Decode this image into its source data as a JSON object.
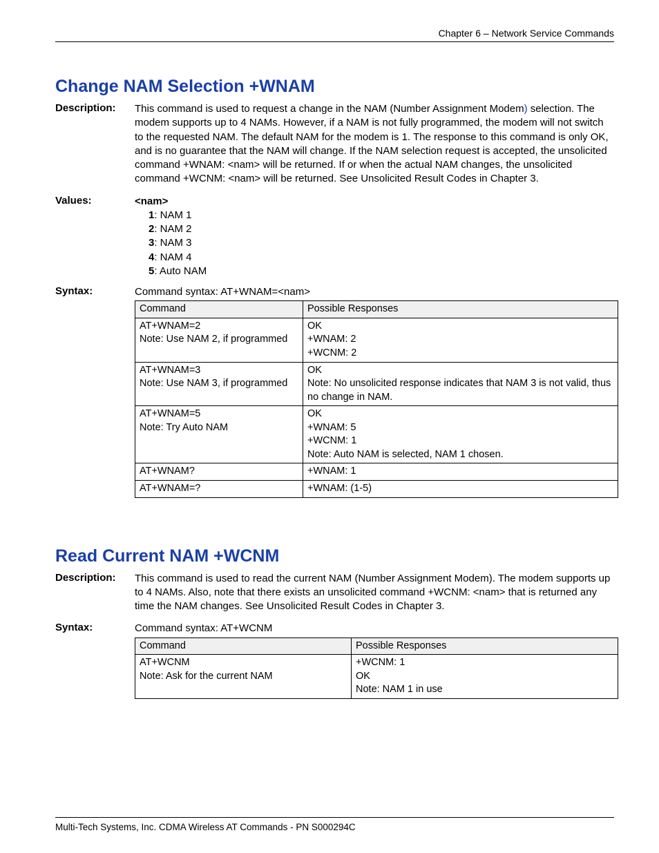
{
  "header": {
    "chapter": "Chapter 6 – Network Service Commands"
  },
  "section1": {
    "title": "Change NAM Selection  +WNAM",
    "labels": {
      "description": "Description:",
      "values": "Values:",
      "syntax": "Syntax:"
    },
    "description_a": "This command is used to request a change in the NAM (Number Assignment Modem",
    "description_paren": ")",
    "description_b": " selection. The modem supports up to 4 NAMs. However, if a NAM is not fully programmed, the modem will not switch to the requested NAM. The default NAM for the modem is 1. The response to this command is only OK, and is no guarantee that the NAM will change. If the NAM selection request is accepted, the unsolicited command +WNAM: <nam> will be returned. If or when the actual NAM changes, the unsolicited command +WCNM: <nam> will be returned. See Unsolicited Result Codes in Chapter 3.",
    "values_header": "<nam>",
    "values": [
      {
        "n": "1",
        "t": ": NAM 1"
      },
      {
        "n": "2",
        "t": ": NAM 2"
      },
      {
        "n": "3",
        "t": ": NAM 3"
      },
      {
        "n": "4",
        "t": ": NAM 4"
      },
      {
        "n": "5",
        "t": ": Auto NAM"
      }
    ],
    "syntax_line": "Command syntax: AT+WNAM=<nam>",
    "table": {
      "head": {
        "c1": "Command",
        "c2": "Possible Responses"
      },
      "rows": [
        {
          "c1": [
            "AT+WNAM=2",
            "Note: Use NAM 2, if programmed"
          ],
          "c2": [
            "OK",
            "+WNAM: 2",
            "+WCNM: 2"
          ]
        },
        {
          "c1": [
            "AT+WNAM=3",
            "Note: Use NAM 3, if programmed"
          ],
          "c2": [
            "OK",
            "Note: No unsolicited response indicates that NAM 3 is not valid, thus no change in NAM."
          ]
        },
        {
          "c1": [
            "AT+WNAM=5",
            "Note: Try Auto NAM"
          ],
          "c2": [
            "OK",
            "+WNAM: 5",
            "+WCNM: 1",
            "Note: Auto NAM is selected, NAM 1 chosen."
          ]
        },
        {
          "c1": [
            "AT+WNAM?"
          ],
          "c2": [
            "+WNAM: 1"
          ]
        },
        {
          "c1": [
            "AT+WNAM=?"
          ],
          "c2": [
            "+WNAM: (1-5)"
          ]
        }
      ]
    }
  },
  "section2": {
    "title": "Read Current NAM  +WCNM",
    "labels": {
      "description": "Description:",
      "syntax": "Syntax:"
    },
    "description": "This command is used to read the current NAM (Number Assignment Modem). The modem supports up to 4 NAMs. Also, note that there exists an unsolicited command +WCNM: <nam> that is returned any time the NAM changes. See Unsolicited Result Codes in Chapter 3.",
    "syntax_line": "Command syntax: AT+WCNM",
    "table": {
      "head": {
        "c1": "Command",
        "c2": "Possible Responses"
      },
      "rows": [
        {
          "c1": [
            "AT+WCNM",
            "Note: Ask for the current NAM"
          ],
          "c2": [
            "+WCNM: 1",
            "OK",
            "Note: NAM 1 in use"
          ]
        }
      ]
    }
  },
  "footer": {
    "text": "Multi-Tech Systems, Inc. CDMA Wireless AT Commands - PN S000294C"
  }
}
